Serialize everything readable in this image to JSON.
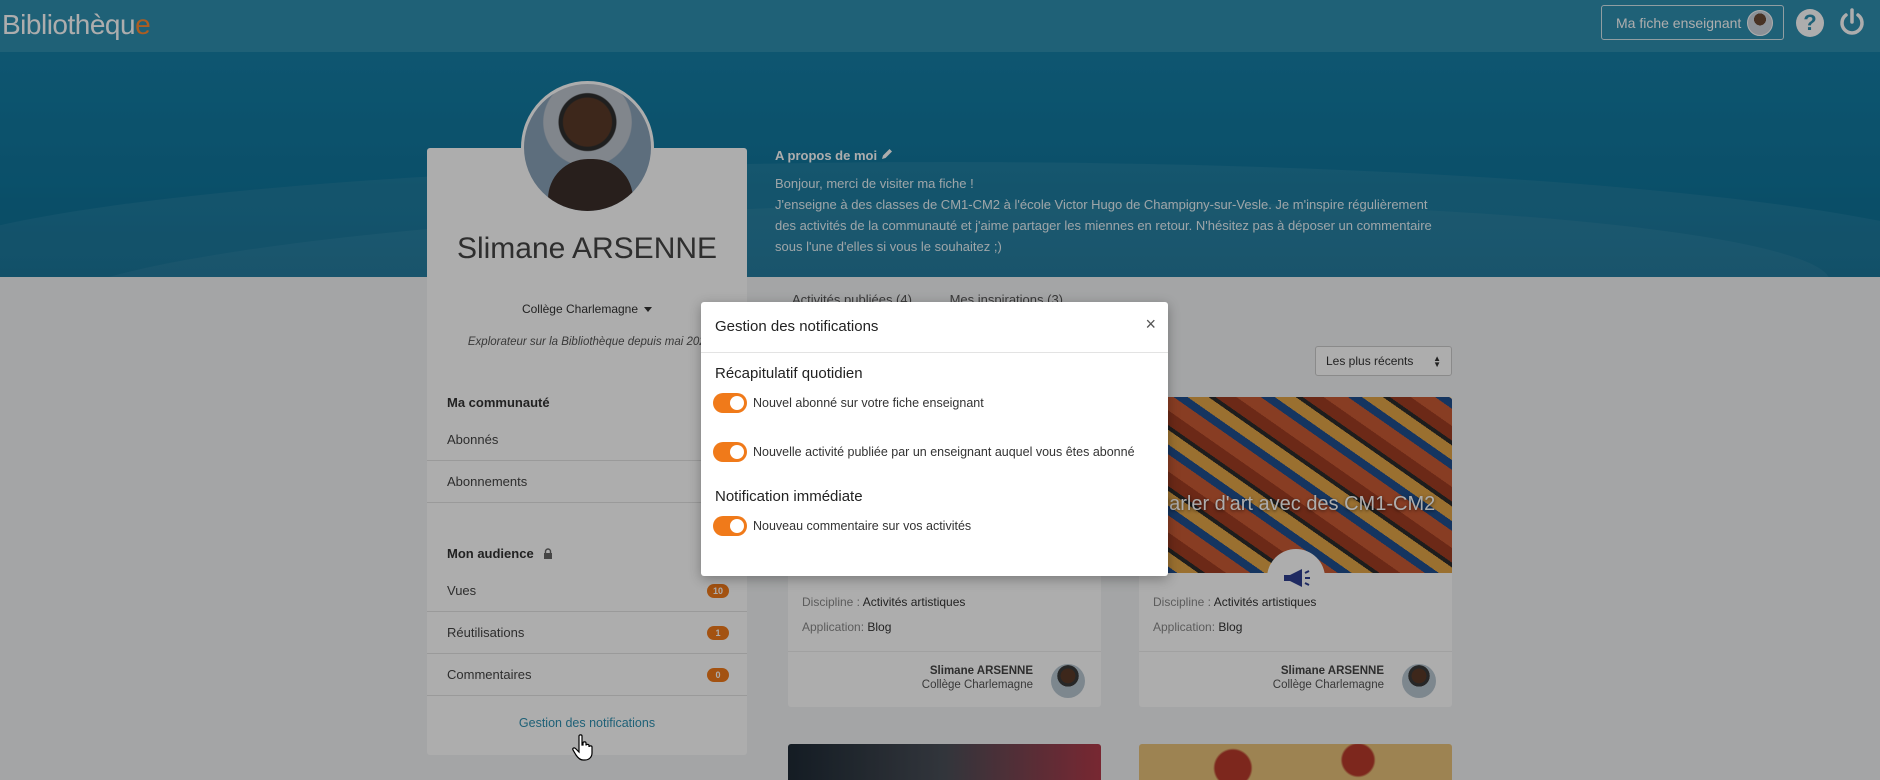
{
  "header": {
    "logo_main": "Bibliothèqu",
    "logo_accent": "e",
    "fiche_button": "Ma fiche enseignant",
    "help_glyph": "?"
  },
  "profile": {
    "name": "Slimane ARSENNE",
    "school": "Collège Charlemagne",
    "explorer": "Explorateur sur la Bibliothèque depuis mai 2021",
    "community_title": "Ma communauté",
    "community_items": [
      "Abonnés",
      "Abonnements"
    ],
    "audience_title": "Mon audience",
    "audience_items": [
      {
        "label": "Vues",
        "count": "10"
      },
      {
        "label": "Réutilisations",
        "count": "1"
      },
      {
        "label": "Commentaires",
        "count": "0"
      }
    ],
    "notif_link": "Gestion des notifications"
  },
  "about": {
    "title": "A propos de moi",
    "line1": "Bonjour, merci de visiter ma fiche !",
    "line2": "J'enseigne à des classes de CM1-CM2 à l'école Victor Hugo de Champigny-sur-Vesle. Je m'inspire régulièrement des activités de la communauté et j'aime partager les miennes en retour. N'hésitez pas à déposer un commentaire sous l'une d'elles si vous le souhaitez ;)"
  },
  "tabs": [
    "Activités publiées (4)",
    "Mes inspirations (3)"
  ],
  "sort": {
    "selected": "Les plus récents"
  },
  "cards": [
    {
      "title": "",
      "discipline_label": "Discipline :",
      "discipline": "Activités artistiques",
      "app_label": "Application:",
      "app": "Blog",
      "author": "Slimane ARSENNE",
      "school": "Collège Charlemagne"
    },
    {
      "title": "Parler d'art avec des CM1-CM2",
      "discipline_label": "Discipline :",
      "discipline": "Activités artistiques",
      "app_label": "Application:",
      "app": "Blog",
      "author": "Slimane ARSENNE",
      "school": "Collège Charlemagne"
    }
  ],
  "modal": {
    "title": "Gestion des notifications",
    "close": "×",
    "section1": "Récapitulatif quotidien",
    "toggle1": "Nouvel abonné sur votre fiche enseignant",
    "toggle2": "Nouvelle activité publiée par un enseignant auquel vous êtes abonné",
    "section2": "Notification immédiate",
    "toggle3": "Nouveau commentaire sur vos activités"
  },
  "colors": {
    "topbar": "#2f8fb0",
    "accent": "#f07a1a",
    "hero": "#157fa6"
  }
}
